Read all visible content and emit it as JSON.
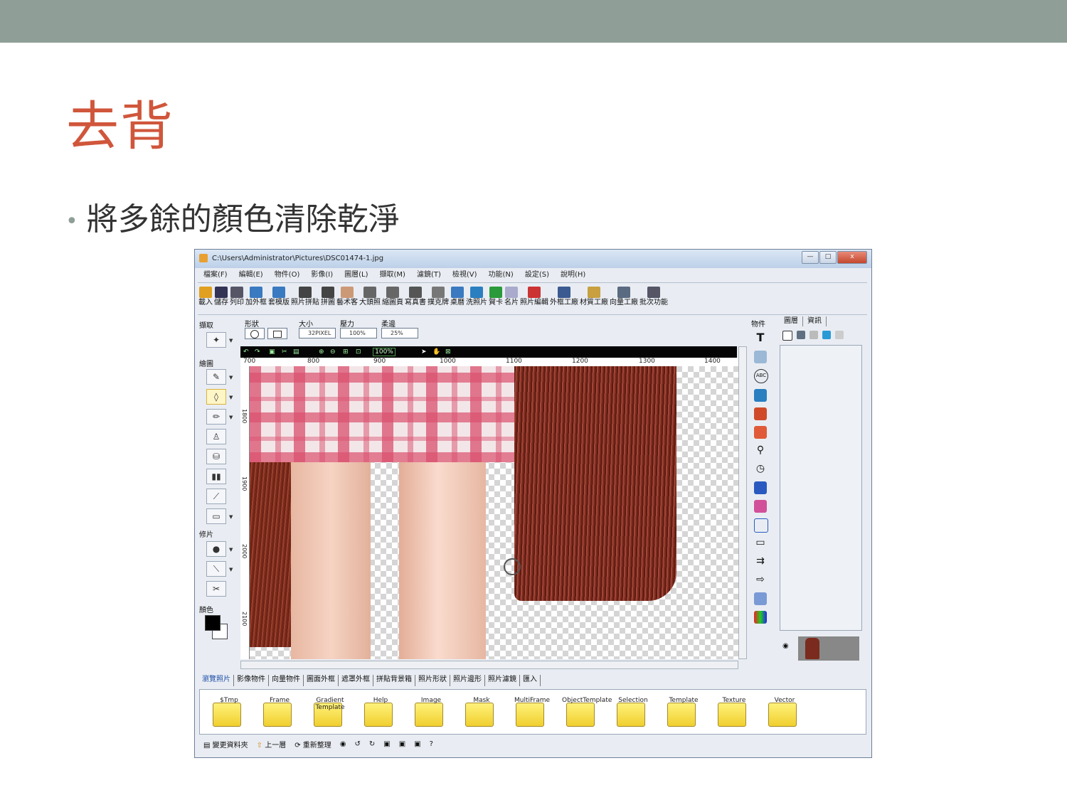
{
  "slide": {
    "title": "去背",
    "bullet": "將多餘的顏色清除乾淨"
  },
  "window": {
    "title": "C:\\Users\\Administrator\\Pictures\\DSC01474-1.jpg",
    "controls": [
      "—",
      "□",
      "x"
    ]
  },
  "menu": [
    "檔案(F)",
    "編輯(E)",
    "物件(O)",
    "影像(I)",
    "圖層(L)",
    "擷取(M)",
    "濾鏡(T)",
    "檢視(V)",
    "功能(N)",
    "設定(S)",
    "說明(H)"
  ],
  "toolbar": [
    "載入",
    "儲存",
    "列印",
    "加外框",
    "套模版",
    "照片拼貼",
    "拼圖",
    "藝术客",
    "大頭照",
    "縮圖頁",
    "寫真書",
    "撲克牌",
    "桌曆",
    "洗照片",
    "賀卡",
    "名片",
    "照片編輯",
    "外框工廠",
    "材質工廠",
    "向量工廠",
    "批次功能"
  ],
  "left_panel": {
    "select_label": "擷取",
    "draw_label": "繪圖",
    "retouch_label": "修片",
    "color_label": "顏色"
  },
  "options": {
    "shape_label": "形狀",
    "size_label": "大小",
    "pressure_label": "壓力",
    "softness_label": "柔邊",
    "size_value": "32PIXEL",
    "pressure_value": "100%",
    "softness_value": "25%"
  },
  "canvas": {
    "zoom": "100%",
    "ruler_h": [
      "700",
      "800",
      "900",
      "1000",
      "1100",
      "1200",
      "1300",
      "1400"
    ],
    "ruler_v": [
      "1800",
      "1900",
      "2000",
      "2100"
    ]
  },
  "object_panel": {
    "label": "物件"
  },
  "right_panel": {
    "tabs": [
      "圖層",
      "資訊"
    ]
  },
  "bottom_tabs": [
    "瀏覽照片",
    "影像物件",
    "向量物件",
    "圖面外框",
    "遮罩外框",
    "拼貼背景箱",
    "照片形狀",
    "照片邊形",
    "照片濾鏡",
    "匯入"
  ],
  "folders": [
    "$Tmp",
    "Frame",
    "Gradient Template",
    "Help",
    "Image",
    "Mask",
    "MultiFrame",
    "ObjectTemplate",
    "Selection",
    "Template",
    "Texture",
    "Vector"
  ],
  "status": {
    "change_folder": "變更資料夾",
    "up": "上一層",
    "refresh": "重新整理",
    "help": "?"
  }
}
